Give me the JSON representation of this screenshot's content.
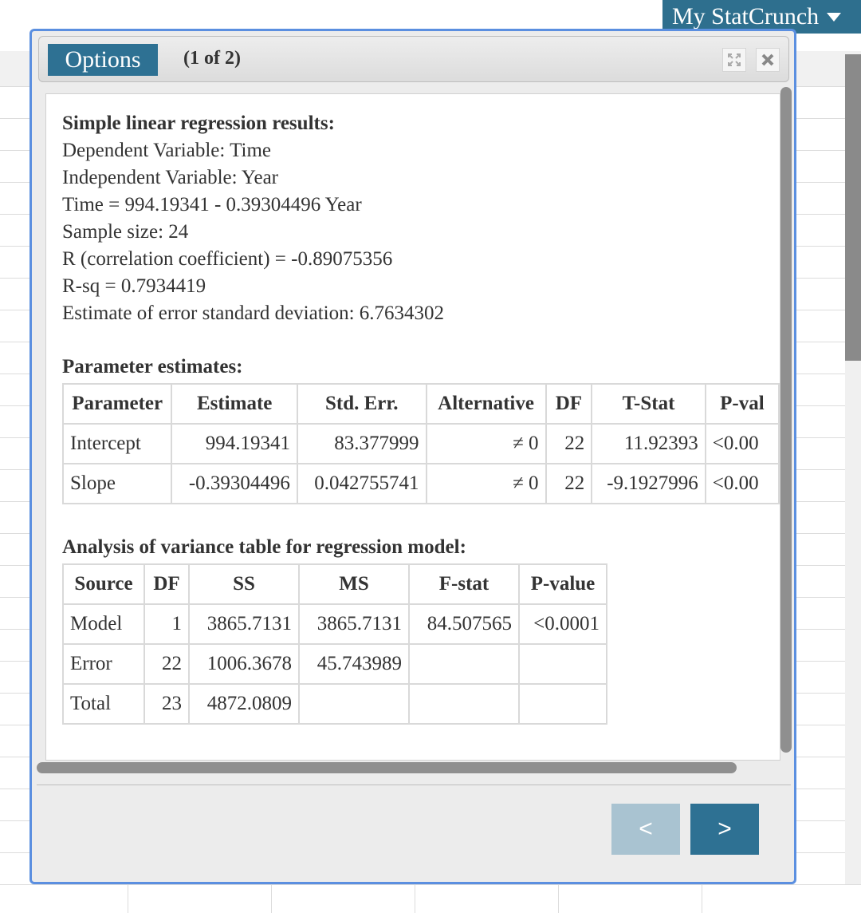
{
  "header": {
    "account_menu_label": "My StatCrunch"
  },
  "dialog": {
    "options_label": "Options",
    "page_indicator": "(1 of 2)",
    "results": {
      "title": "Simple linear regression results:",
      "dependent": "Dependent Variable: Time",
      "independent": "Independent Variable: Year",
      "equation": "Time = 994.19341 - 0.39304496 Year",
      "sample_size": "Sample size: 24",
      "r": "R (correlation coefficient) = -0.89075356",
      "rsq": "R-sq = 0.7934419",
      "std_dev": "Estimate of error standard deviation: 6.7634302"
    },
    "params": {
      "heading": "Parameter estimates:",
      "headers": [
        "Parameter",
        "Estimate",
        "Std. Err.",
        "Alternative",
        "DF",
        "T-Stat",
        "P-val"
      ],
      "rows": [
        [
          "Intercept",
          "994.19341",
          "83.377999",
          "≠ 0",
          "22",
          "11.92393",
          "<0.00"
        ],
        [
          "Slope",
          "-0.39304496",
          "0.042755741",
          "≠ 0",
          "22",
          "-9.1927996",
          "<0.00"
        ]
      ]
    },
    "anova": {
      "heading": "Analysis of variance table for regression model:",
      "headers": [
        "Source",
        "DF",
        "SS",
        "MS",
        "F-stat",
        "P-value"
      ],
      "rows": [
        [
          "Model",
          "1",
          "3865.7131",
          "3865.7131",
          "84.507565",
          "<0.0001"
        ],
        [
          "Error",
          "22",
          "1006.3678",
          "45.743989",
          "",
          ""
        ],
        [
          "Total",
          "23",
          "4872.0809",
          "",
          "",
          ""
        ]
      ]
    },
    "nav": {
      "prev_label": "<",
      "next_label": ">"
    }
  }
}
